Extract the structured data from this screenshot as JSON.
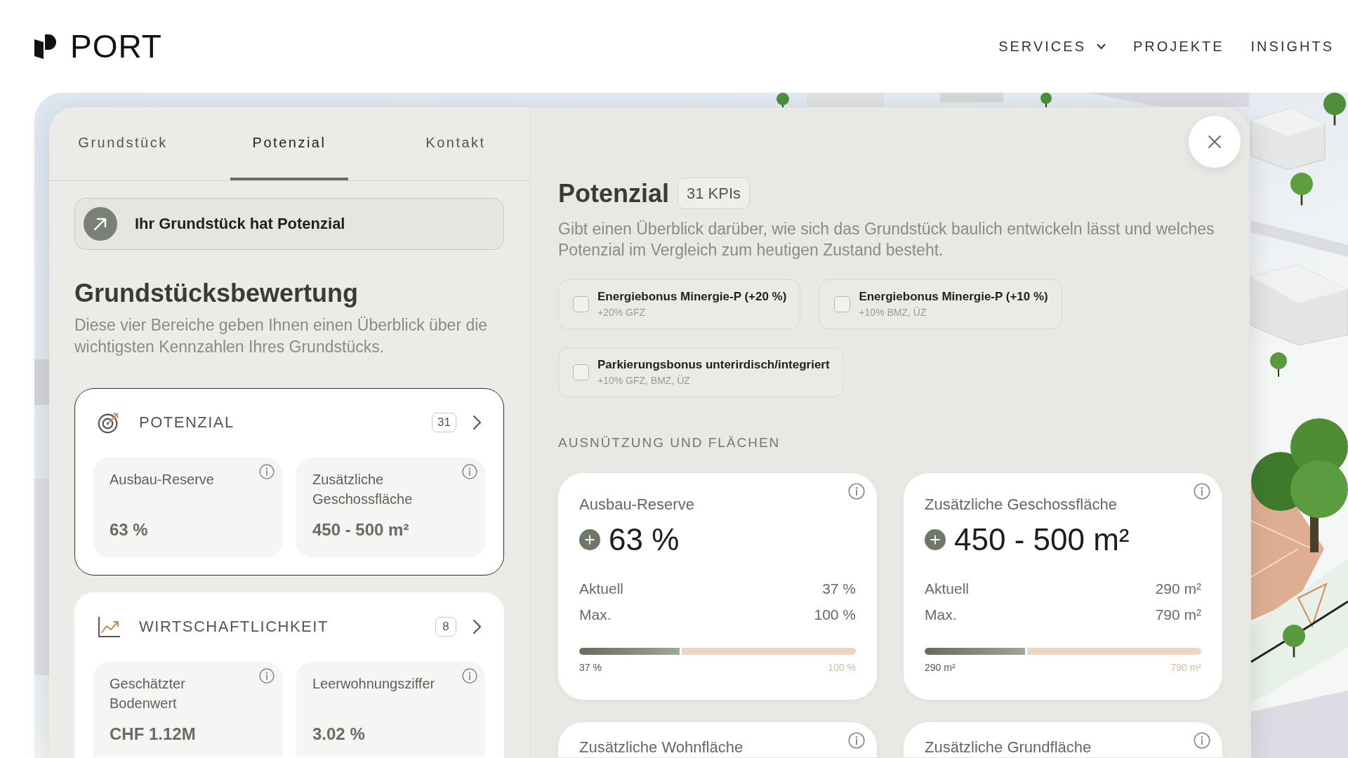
{
  "header": {
    "logo": "PORT",
    "nav": [
      {
        "label": "SERVICES",
        "dropdown": true
      },
      {
        "label": "PROJEKTE",
        "dropdown": false
      },
      {
        "label": "INSIGHTS",
        "dropdown": false
      }
    ]
  },
  "tabs": [
    {
      "label": "Grundstück",
      "selected": false
    },
    {
      "label": "Potenzial",
      "selected": true
    },
    {
      "label": "Kontakt",
      "selected": false
    }
  ],
  "banner": {
    "text": "Ihr Grundstück hat Potenzial"
  },
  "overview": {
    "title": "Grundstücksbewertung",
    "description": "Diese vier Bereiche geben Ihnen einen Überblick über die wichtigsten Kennzahlen Ihres Grundstücks."
  },
  "categories": [
    {
      "title": "POTENZIAL",
      "count": "31",
      "selected": true,
      "metrics": [
        {
          "label": "Ausbau-Reserve",
          "value": "63 %"
        },
        {
          "label": "Zusätzliche Geschossfläche",
          "value": "450 - 500 m²"
        }
      ]
    },
    {
      "title": "WIRTSCHAFTLICHKEIT",
      "count": "8",
      "selected": false,
      "metrics": [
        {
          "label": "Geschätzter Bodenwert",
          "value": "CHF 1.12M"
        },
        {
          "label": "Leerwohnungsziffer",
          "value": "3.02 %"
        }
      ]
    }
  ],
  "detail": {
    "title": "Potenzial",
    "badge": "31 KPIs",
    "description": "Gibt einen Überblick darüber, wie sich das Grundstück baulich entwickeln lässt und welches Potenzial im Vergleich zum heutigen Zustand besteht.",
    "bonuses": [
      {
        "title": "Energiebonus Minergie-P (+20 %)",
        "subtitle": "+20% GFZ",
        "checked": false
      },
      {
        "title": "Energiebonus Minergie-P (+10 %)",
        "subtitle": "+10% BMZ, ÜZ",
        "checked": false
      },
      {
        "title": "Parkierungsbonus unterirdisch/integriert",
        "subtitle": "+10% GFZ, BMZ, ÜZ",
        "checked": false
      }
    ],
    "section_title": "AUSNÜTZUNG UND FLÄCHEN",
    "kpis": [
      {
        "title": "Ausbau-Reserve",
        "value": "63 %",
        "rows": [
          {
            "label": "Aktuell",
            "value": "37 %"
          },
          {
            "label": "Max.",
            "value": "100 %"
          }
        ],
        "level": 0.37,
        "bar_start": "37 %",
        "bar_end": "100 %"
      },
      {
        "title": "Zusätzliche Geschossfläche",
        "value": "450 - 500 m²",
        "rows": [
          {
            "label": "Aktuell",
            "value": "290 m²"
          },
          {
            "label": "Max.",
            "value": "790 m²"
          }
        ],
        "level": 0.37,
        "bar_start": "290 m²",
        "bar_end": "790 m²"
      },
      {
        "title": "Zusätzliche Wohnfläche"
      },
      {
        "title": "Zusätzliche Grundfläche"
      }
    ]
  }
}
